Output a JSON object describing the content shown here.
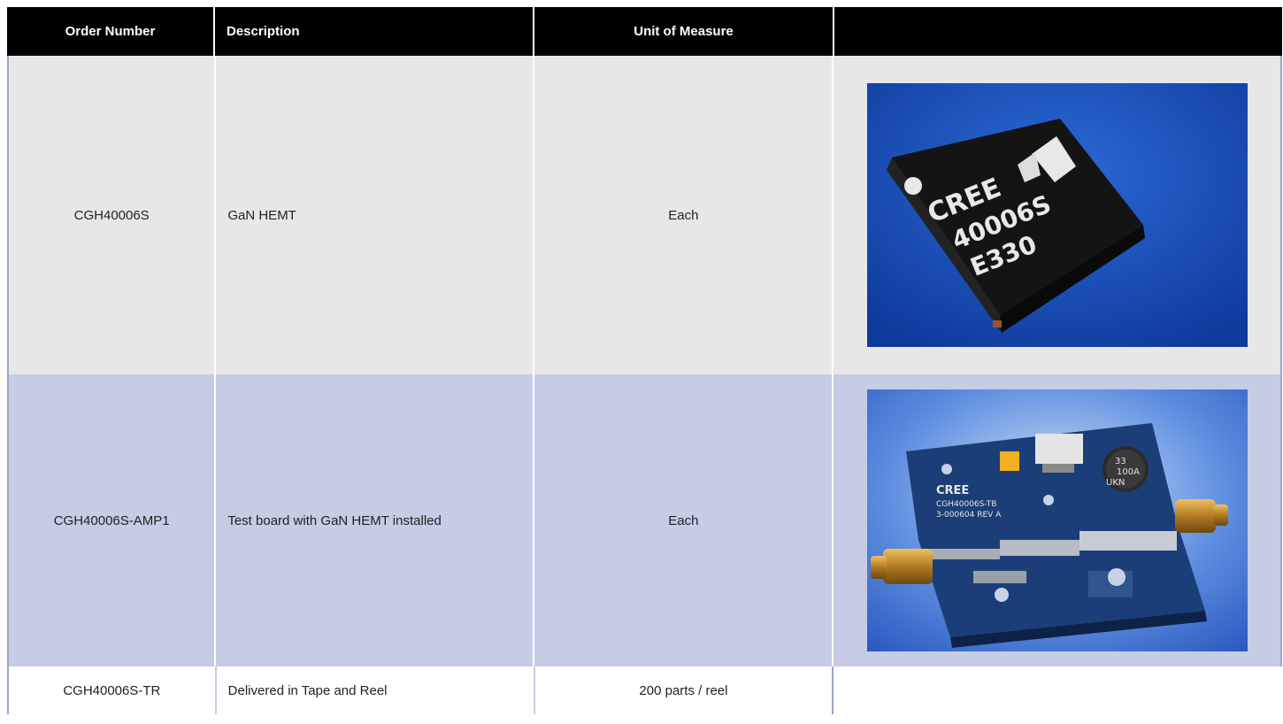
{
  "table": {
    "headers": [
      "Order Number",
      "Description",
      "Unit of Measure",
      ""
    ],
    "rows": [
      {
        "order_number": "CGH40006S",
        "description": "GaN HEMT",
        "unit": "Each",
        "image": {
          "name": "transistor-package-photo",
          "chip_text": [
            "CREE",
            "40006S",
            "E330"
          ],
          "bg_color": "#1d4fb8"
        }
      },
      {
        "order_number": "CGH40006S-AMP1",
        "description": "Test board with GaN HEMT installed",
        "unit": "Each",
        "image": {
          "name": "test-board-photo",
          "board_text": [
            "CREE",
            "CGH40006S-TB",
            "3-000604 REV A",
            "33",
            "100A",
            "UKN"
          ],
          "bg_color": "#2a62c9"
        }
      },
      {
        "order_number": "CGH40006S-TR",
        "description": "Delivered in Tape and Reel",
        "unit": "200 parts / reel",
        "image": null
      }
    ]
  },
  "colors": {
    "header_bg": "#000000",
    "row1_bg": "#e6e7e8",
    "row2_bg": "#c5cce4",
    "border": "#9ba6cc"
  }
}
